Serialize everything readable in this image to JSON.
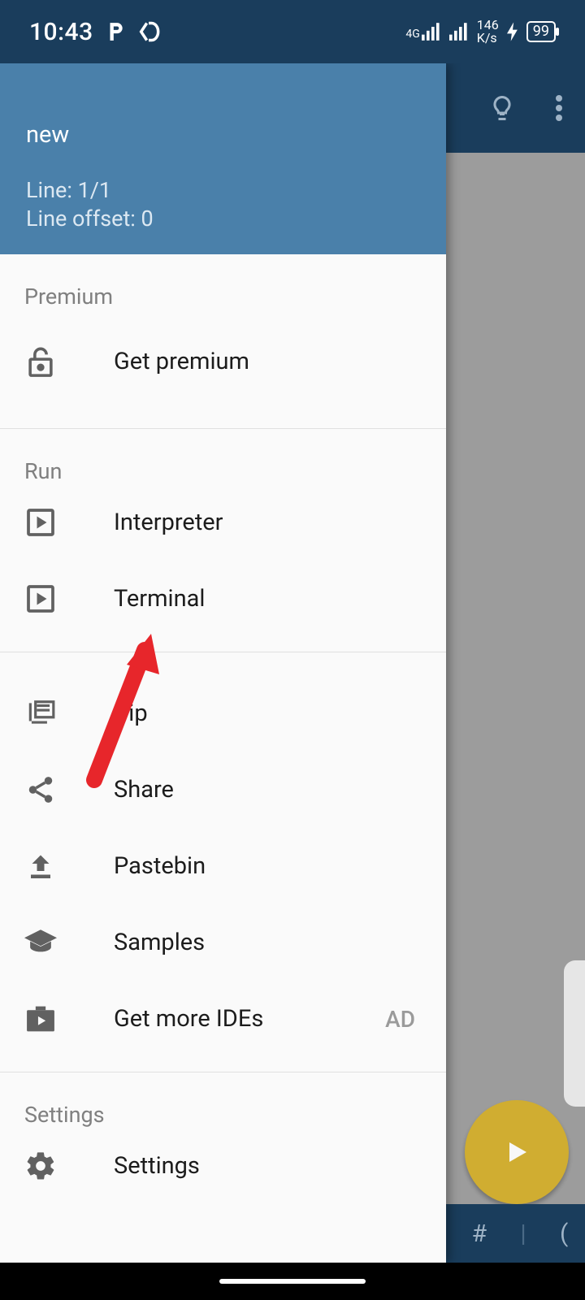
{
  "status": {
    "time": "10:43",
    "net_speed_top": "146",
    "net_speed_unit": "K/s",
    "battery": "99",
    "signal_gen": "4G"
  },
  "drawer": {
    "title": "new",
    "line": "Line: 1/1",
    "offset": "Line offset: 0",
    "sections": {
      "premium": {
        "label": "Premium",
        "get_premium": "Get premium"
      },
      "run": {
        "label": "Run",
        "interpreter": "Interpreter",
        "terminal": "Terminal"
      },
      "tools": {
        "pip": "Pip",
        "share": "Share",
        "pastebin": "Pastebin",
        "samples": "Samples",
        "more_ides": "Get more IDEs",
        "ad": "AD"
      },
      "settings": {
        "label": "Settings",
        "settings": "Settings"
      }
    }
  },
  "symbar": {
    "hash": "#",
    "paren": "("
  }
}
